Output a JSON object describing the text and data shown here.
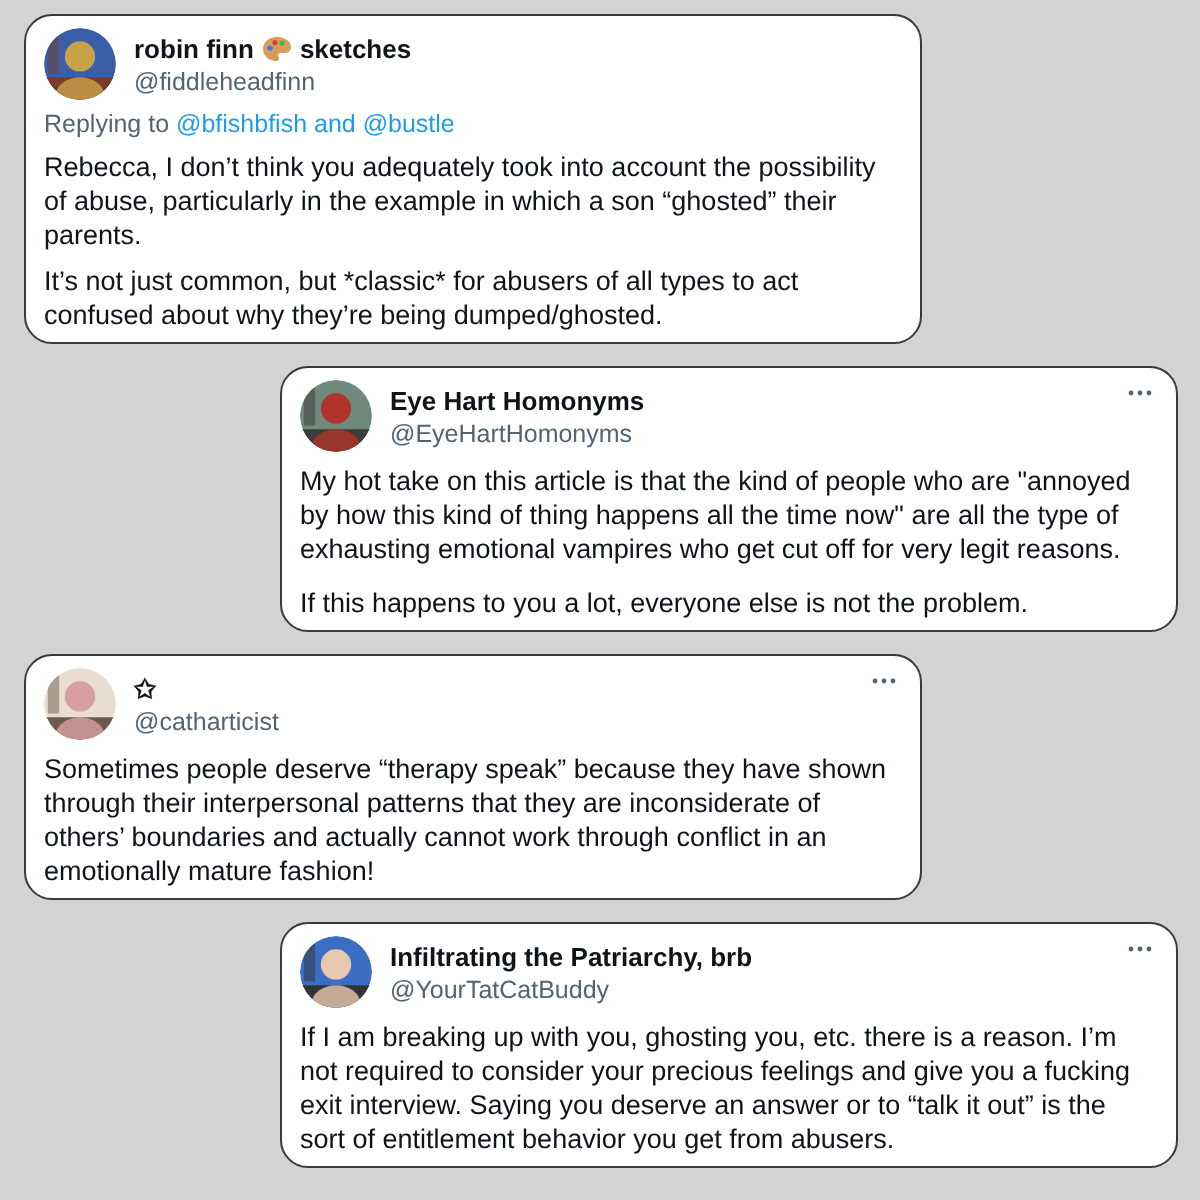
{
  "tweets": [
    {
      "name": "robin finn",
      "palette_emoji": true,
      "name_suffix": "sketches",
      "handle": "@fiddleheadfinn",
      "reply_prefix": "Replying to",
      "reply_to": "@bfishbfish and @bustle",
      "paragraphs": [
        "Rebecca, I don’t think you adequately took into account the possibility of abuse, particularly in the example in which a son “ghosted” their parents.",
        "It’s not just common, but *classic* for abusers of all types to act confused about why they’re being dumped/ghosted."
      ],
      "menu": false,
      "spaced": false
    },
    {
      "name": "Eye Hart Homonyms",
      "handle": "@EyeHartHomonyms",
      "paragraphs": [
        "My hot take on this article is that the kind of people who are \"annoyed by how this kind of thing happens all the time now\" are all the type of exhausting emotional vampires who get cut off for very legit reasons.",
        "If this happens to you a lot, everyone else is not the problem."
      ],
      "menu": true,
      "spaced": true
    },
    {
      "name": "✩",
      "handle": "@catharticist",
      "paragraphs": [
        "Sometimes people deserve “therapy speak” because they have shown through their interpersonal patterns that they are inconsiderate of others’ boundaries and actually cannot work through conflict in an emotionally mature fashion!"
      ],
      "menu": true,
      "spaced": false
    },
    {
      "name": "Infiltrating the Patriarchy, brb",
      "handle": "@YourTatCatBuddy",
      "paragraphs": [
        "If I am breaking up with you, ghosting you, etc. there is a reason. I’m not required to consider your precious feelings and give you a fucking exit interview. Saying you deserve an answer or to “talk it out” is the sort of entitlement behavior you get from abusers."
      ],
      "menu": true,
      "spaced": false
    }
  ]
}
